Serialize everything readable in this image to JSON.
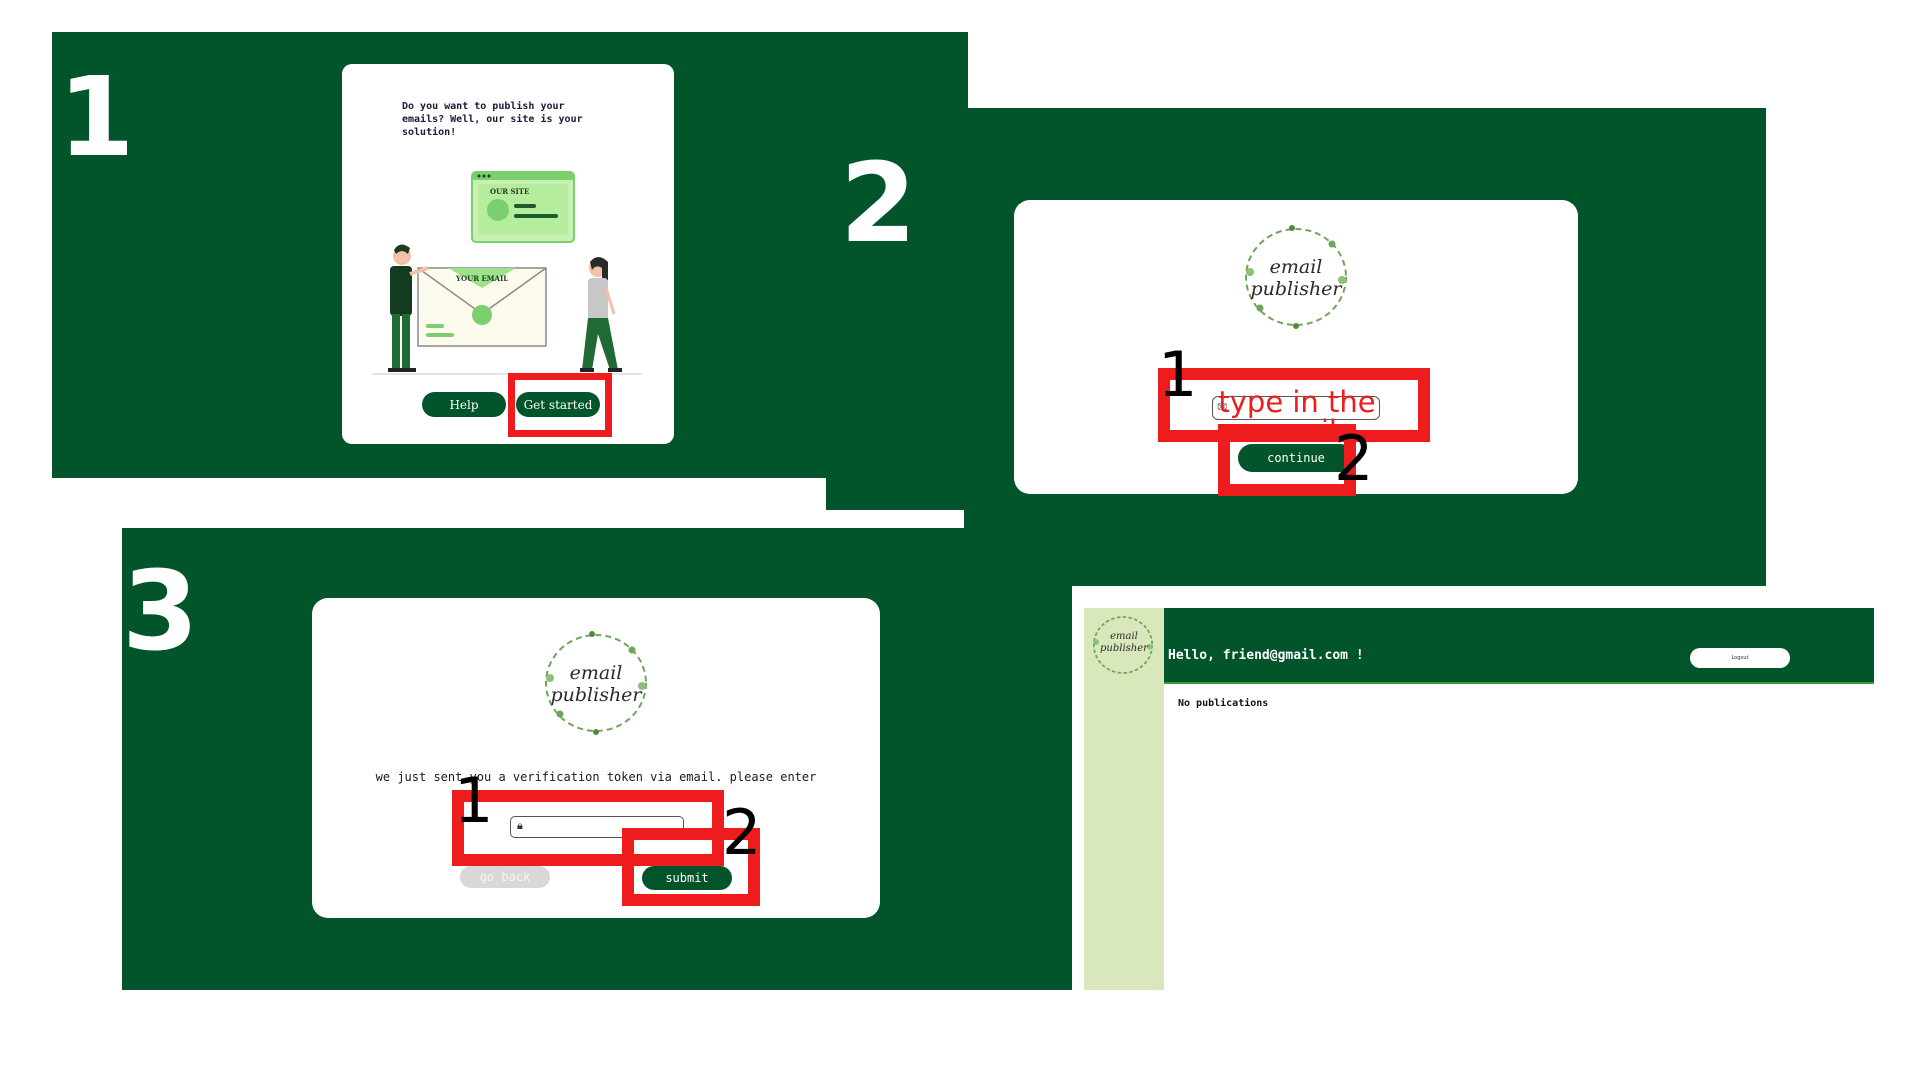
{
  "colors": {
    "brand_green": "#02542a",
    "highlight_red": "#ee1c1c",
    "sidebar_green": "#d9e8bb",
    "accent_green": "#7ccf6e"
  },
  "panel1": {
    "step_number": "1",
    "intro_text": "Do you want to publish your emails? Well, our site is your solution!",
    "illustration": {
      "site_label": "OUR SITE",
      "envelope_label": "YOUR EMAIL"
    },
    "help_label": "Help",
    "get_started_label": "Get started"
  },
  "panel2": {
    "step_number": "2",
    "logo": {
      "line1": "email",
      "line2": "publisher"
    },
    "email_hint": "type in the email",
    "continue_label": "continue",
    "annot1": "1",
    "annot2": "2"
  },
  "panel3": {
    "step_number": "3",
    "logo": {
      "line1": "email",
      "line2": "publisher"
    },
    "message": "we just sent you a verification token via email. please enter it below",
    "go_back_label": "go back",
    "submit_label": "submit",
    "annot1": "1",
    "annot2": "2"
  },
  "panel4": {
    "logo": {
      "line1": "email",
      "line2": "publisher"
    },
    "greeting": "Hello, friend@gmail.com !",
    "logout_label": "Logout",
    "empty_text": "No publications"
  }
}
